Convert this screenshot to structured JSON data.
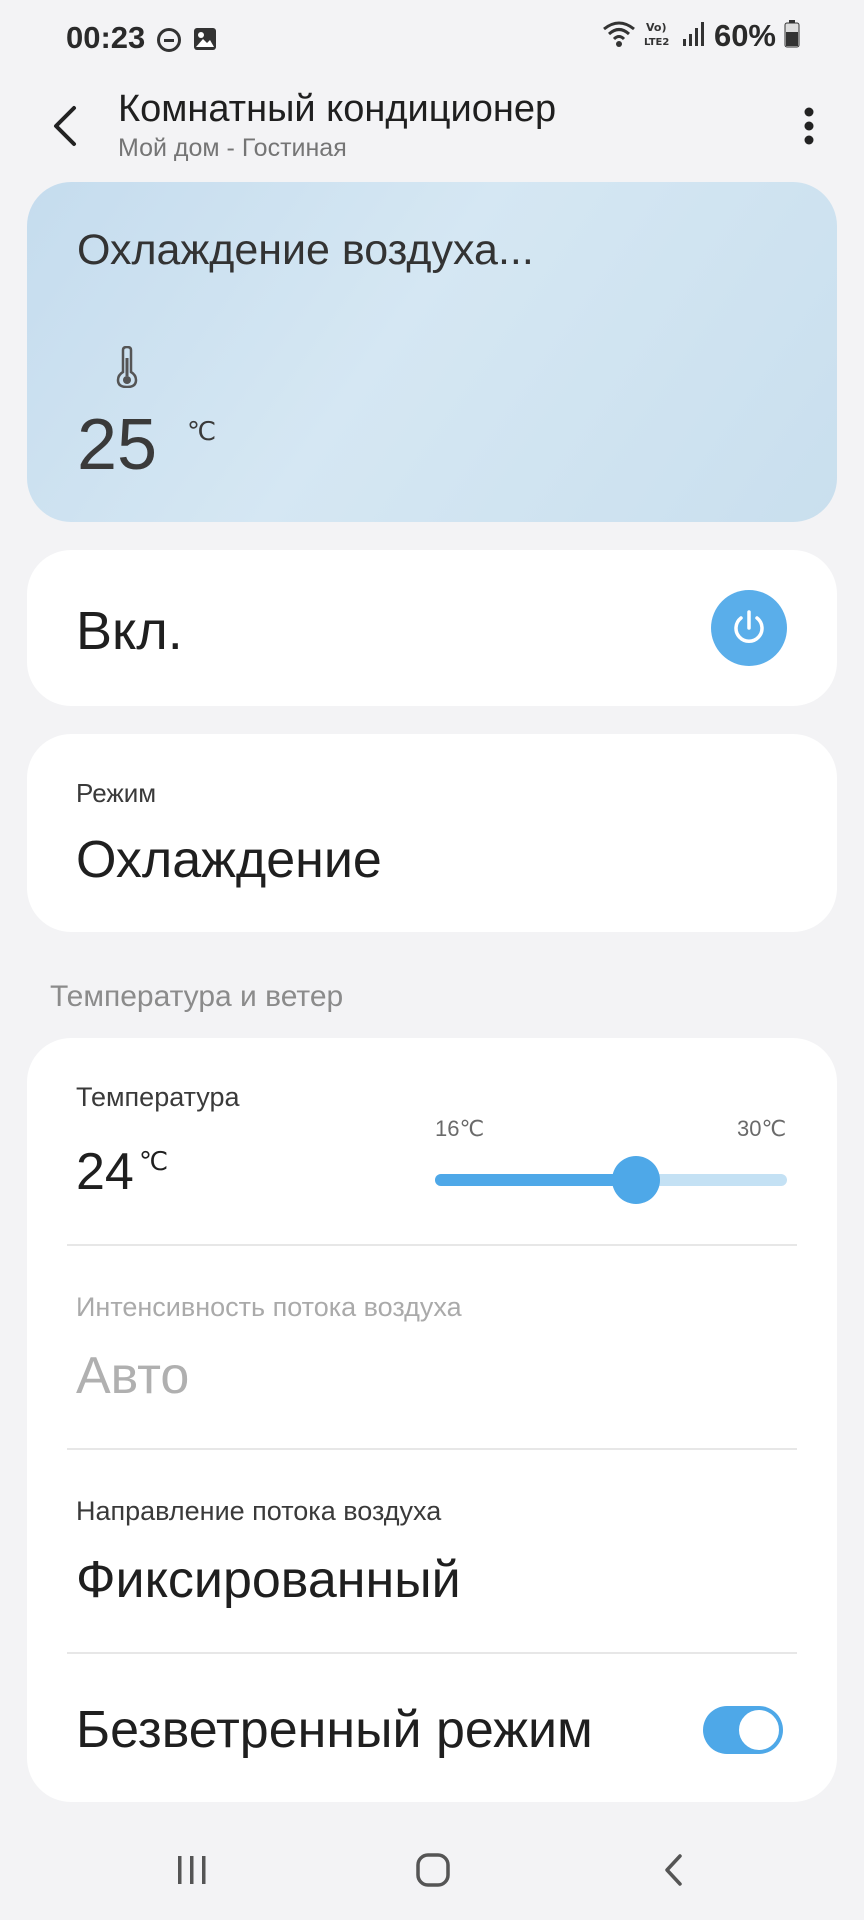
{
  "status_bar": {
    "time": "00:23",
    "battery": "60%",
    "icons": [
      "do-not-disturb-icon",
      "gallery-icon",
      "wifi-icon",
      "volte-icon",
      "signal-icon",
      "battery-icon"
    ]
  },
  "app_bar": {
    "title": "Комнатный кондиционер",
    "subtitle": "Мой дом - Гостиная"
  },
  "status_card": {
    "title": "Охлаждение воздуха...",
    "current_temp": "25",
    "unit": "℃"
  },
  "power": {
    "label": "Вкл.",
    "state": "on"
  },
  "mode": {
    "label": "Режим",
    "value": "Охлаждение"
  },
  "section_header": "Температура и ветер",
  "temperature": {
    "label": "Температура",
    "value": "24",
    "unit": "℃",
    "min_label": "16℃",
    "max_label": "30℃",
    "min": 16,
    "max": 30,
    "current": 24
  },
  "airflow": {
    "label": "Интенсивность потока воздуха",
    "value": "Авто"
  },
  "direction": {
    "label": "Направление потока воздуха",
    "value": "Фиксированный"
  },
  "windless": {
    "label": "Безветренный режим",
    "enabled": true
  },
  "colors": {
    "accent": "#4ea8e8",
    "power_button": "#5aaeea",
    "status_card": "#cfe3f1"
  }
}
